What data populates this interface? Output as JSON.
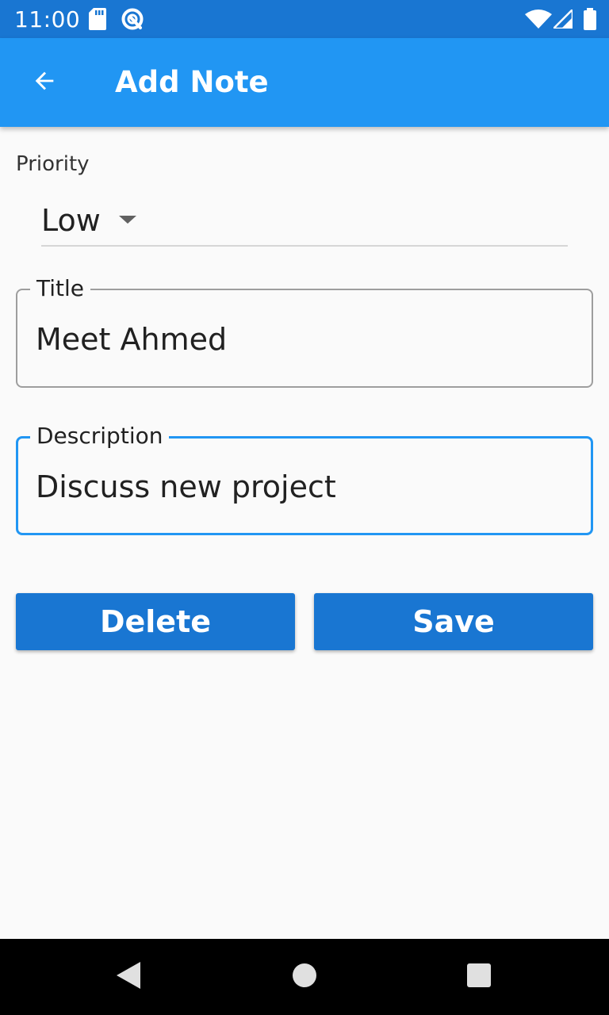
{
  "status_bar": {
    "time": "11:00",
    "icons": [
      "sd-card-icon",
      "sync-icon",
      "wifi-icon",
      "signal-icon",
      "battery-icon"
    ]
  },
  "app_bar": {
    "title": "Add Note",
    "back_icon": "arrow-back-icon",
    "background": "#2196f3"
  },
  "form": {
    "priority": {
      "label": "Priority",
      "selected": "Low"
    },
    "title_field": {
      "label": "Title",
      "value": "Meet Ahmed"
    },
    "description_field": {
      "label": "Description",
      "value": "Discuss new project",
      "focused": true
    }
  },
  "buttons": {
    "delete_label": "Delete",
    "save_label": "Save",
    "color": "#1976d2"
  },
  "nav_bar": {
    "icons": [
      "back-triangle-icon",
      "home-circle-icon",
      "recents-square-icon"
    ]
  }
}
